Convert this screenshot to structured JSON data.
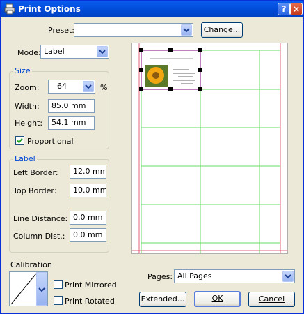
{
  "window": {
    "title": "Print Options",
    "help_label": "?",
    "close_label": "×"
  },
  "preset": {
    "label": "Preset:",
    "value": "",
    "change_label": "Change..."
  },
  "mode": {
    "label": "Mode:",
    "value": "Label"
  },
  "size": {
    "group_label": "Size",
    "zoom_label": "Zoom:",
    "zoom_value": "64",
    "zoom_unit": "%",
    "width_label": "Width:",
    "width_value": "85.0 mm",
    "height_label": "Height:",
    "height_value": "54.1 mm",
    "proportional_label": "Proportional",
    "proportional_checked": true
  },
  "label": {
    "group_label": "Label",
    "left_border_label": "Left Border:",
    "left_border_value": "12.0 mm",
    "top_border_label": "Top Border:",
    "top_border_value": "10.0 mm",
    "line_distance_label": "Line Distance:",
    "line_distance_value": "0.0 mm",
    "column_dist_label": "Column Dist.:",
    "column_dist_value": "0.0 mm"
  },
  "calibration": {
    "label": "Calibration",
    "print_mirrored_label": "Print Mirrored",
    "print_mirrored_checked": false,
    "print_rotated_label": "Print Rotated",
    "print_rotated_checked": false
  },
  "pages": {
    "label": "Pages:",
    "value": "All Pages"
  },
  "buttons": {
    "extended_label": "Extended...",
    "ok_label": "OK",
    "cancel_label": "Cancel"
  },
  "colors": {
    "grid_lines": "#66dd66",
    "margin_lines": "#e0607a",
    "selection": "#800080"
  }
}
